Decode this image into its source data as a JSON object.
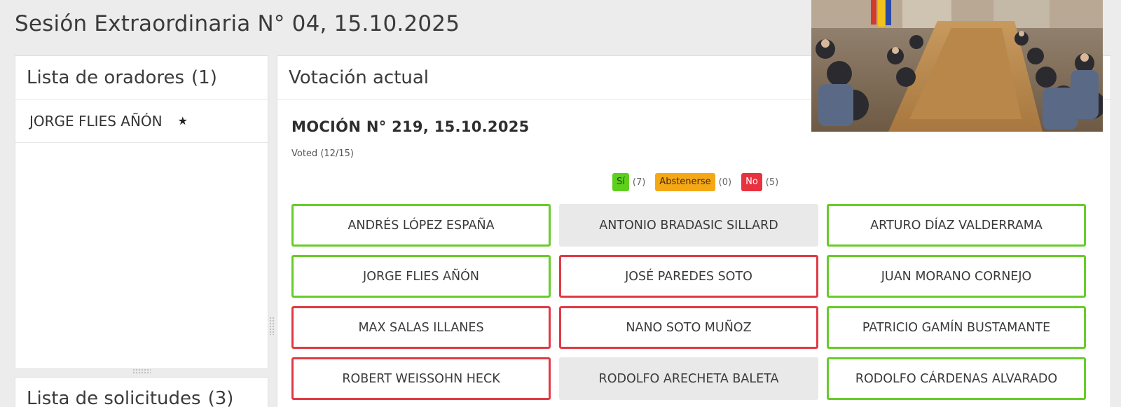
{
  "session": {
    "title": "Sesión Extraordinaria N° 04, 15.10.2025"
  },
  "speakers": {
    "title": "Lista de oradores",
    "count": "(1)",
    "items": [
      {
        "name": "JORGE FLIES AÑÓN",
        "icon": "star-icon"
      }
    ]
  },
  "requests": {
    "title": "Lista de solicitudes",
    "count": "(3)"
  },
  "vote": {
    "title": "Votación actual",
    "motion": "MOCIÓN N° 219, 15.10.2025",
    "voted": "Voted (12/15)",
    "tally": {
      "yes_label": "Sí",
      "yes_count": "(7)",
      "abstain_label": "Abstenerse",
      "abstain_count": "(0)",
      "no_label": "No",
      "no_count": "(5)"
    },
    "colors": {
      "yes": "#66cc2a",
      "no": "#e03a46",
      "abstain": "#f5a816",
      "none": "#e9e9e9"
    },
    "members": [
      {
        "name": "ANDRÉS LÓPEZ ESPAÑA",
        "vote": "yes"
      },
      {
        "name": "ANTONIO BRADASIC SILLARD",
        "vote": "none"
      },
      {
        "name": "ARTURO DÍAZ VALDERRAMA",
        "vote": "yes"
      },
      {
        "name": "JORGE FLIES AÑÓN",
        "vote": "yes"
      },
      {
        "name": "JOSÉ PAREDES SOTO",
        "vote": "no"
      },
      {
        "name": "JUAN MORANO CORNEJO",
        "vote": "yes"
      },
      {
        "name": "MAX SALAS ILLANES",
        "vote": "no"
      },
      {
        "name": "NANO SOTO MUÑOZ",
        "vote": "no"
      },
      {
        "name": "PATRICIO GAMÍN BUSTAMANTE",
        "vote": "yes"
      },
      {
        "name": "ROBERT WEISSOHN HECK",
        "vote": "no"
      },
      {
        "name": "RODOLFO ARECHETA BALETA",
        "vote": "none"
      },
      {
        "name": "RODOLFO CÁRDENAS ALVARADO",
        "vote": "yes"
      }
    ]
  }
}
